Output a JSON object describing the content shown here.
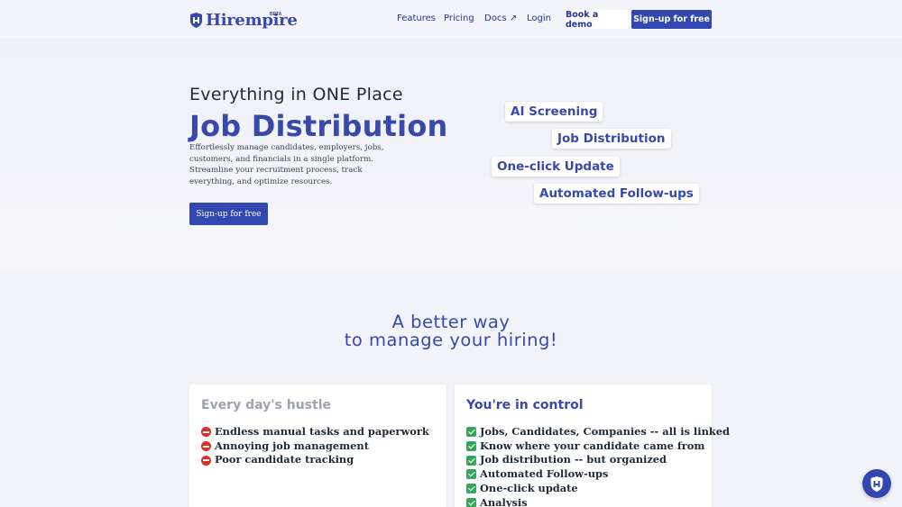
{
  "nav": {
    "brand": "Hirempire",
    "beta": "BETA",
    "links": [
      {
        "label": "Features"
      },
      {
        "label": "Pricing"
      },
      {
        "label": "Docs ↗"
      },
      {
        "label": "Login"
      }
    ],
    "demo_label": "Book a demo",
    "signup_label": "Sign-up for free"
  },
  "hero": {
    "eyebrow": "Everything in ONE Place",
    "title": "Job Distribution",
    "description": "Effortlessly manage candidates, employers, jobs, customers, and financials in a single platform. Streamline your recruitment process, track everything, and optimize resources.",
    "cta_label": "Sign-up for free",
    "chips": [
      "AI Screening",
      "Job Distribution",
      "One-click Update",
      "Automated Follow-ups"
    ]
  },
  "section": {
    "tagline_line1": "A better way",
    "tagline_line2": "to manage your hiring!",
    "hustle": {
      "title": "Every day's hustle",
      "items": [
        "Endless manual tasks and paperwork",
        "Annoying job management",
        "Poor candidate tracking"
      ]
    },
    "control": {
      "title": "You're in control",
      "items": [
        "Jobs, Candidates, Companies -- all is linked",
        "Know where your candidate came from",
        "Job distribution -- but organized",
        "Automated Follow-ups",
        "One-click update",
        "Analysis"
      ]
    }
  },
  "colors": {
    "brand": "#3949ab",
    "button": "#3347b0",
    "muted_title": "#9ca3af",
    "stop": "#d93025",
    "check": "#3aa55d"
  },
  "icons": {
    "logo": "shield-logo-icon",
    "fab": "chat-widget-icon",
    "hustle_marker": "no-entry-icon",
    "control_marker": "check-mark-icon"
  }
}
